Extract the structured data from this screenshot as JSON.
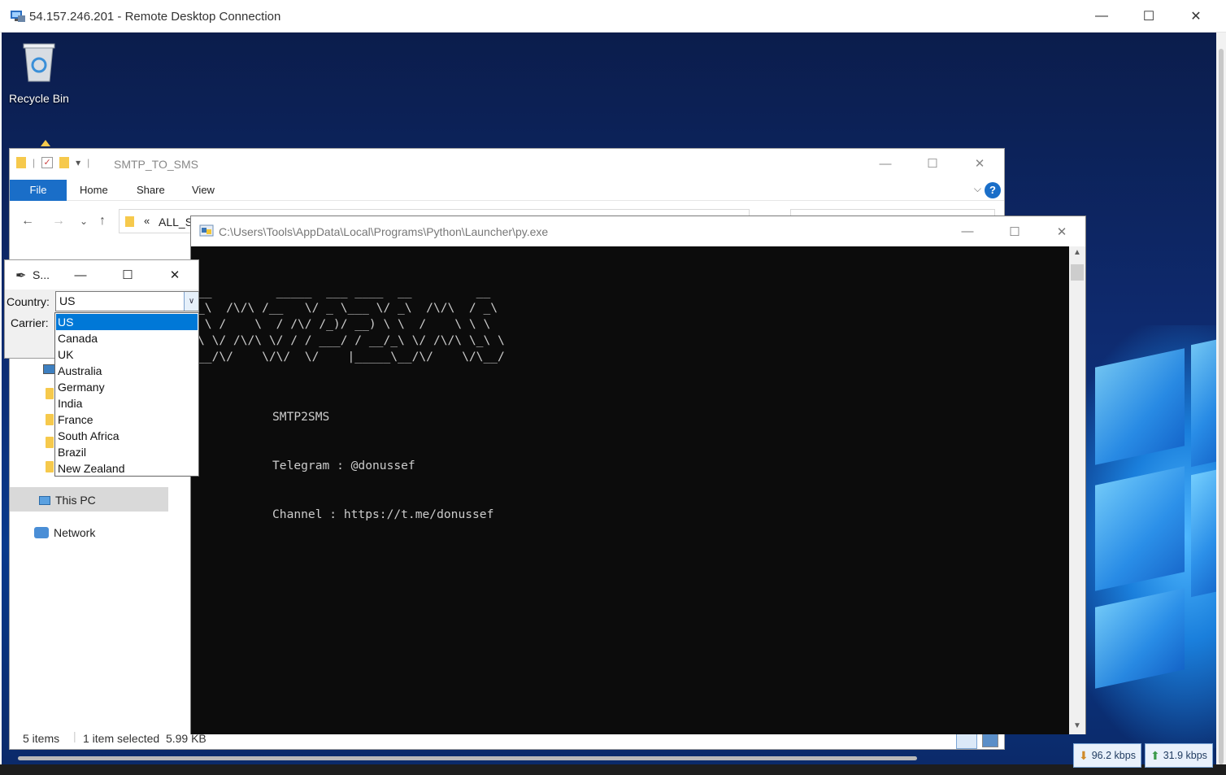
{
  "rdp": {
    "title": "54.157.246.201 - Remote Desktop Connection",
    "minimize_icon": "minimize-icon",
    "maximize_icon": "maximize-icon",
    "close_icon": "close-icon"
  },
  "desktop": {
    "recycle_bin_label": "Recycle Bin"
  },
  "explorer": {
    "title": "SMTP_TO_SMS",
    "ribbon_tabs": [
      "File",
      "Home",
      "Share",
      "View"
    ],
    "address_crumb": "ALL_SI",
    "address_prefix": "«",
    "nav_this_pc": "This PC",
    "nav_network": "Network",
    "status_items": "5 items",
    "status_selected": "1 item selected  5.99 KB"
  },
  "console": {
    "title": "C:\\Users\\Tools\\AppData\\Local\\Programs\\Python\\Launcher\\py.exe",
    "ascii_art": "__         _____  ___ ____  __         __\n_\\  /\\/\\ /__   \\/ _ \\___ \\/ _\\  /\\/\\  / _\\\n \\ /    \\  / /\\/ /_)/ __) \\ \\  /    \\ \\ \\\n\\ \\/ /\\/\\ \\/ / / ___/ / __/_\\ \\/ /\\/\\ \\_\\ \\\n__/\\/    \\/\\/  \\/    |_____\\__/\\/    \\/\\__/",
    "info_lines": [
      "SMTP2SMS",
      "Telegram : @donussef",
      "Channel : https://t.me/donussef"
    ]
  },
  "tkapp": {
    "title": "S...",
    "country_label": "Country:",
    "carrier_label": "Carrier:",
    "country_value": "US",
    "country_options": [
      "US",
      "Canada",
      "UK",
      "Australia",
      "Germany",
      "India",
      "France",
      "South Africa",
      "Brazil",
      "New Zealand"
    ],
    "selected_option": "US"
  },
  "netmeter": {
    "down": "96.2 kbps",
    "up": "31.9 kbps"
  },
  "colors": {
    "accent_blue": "#1a6ec8",
    "selection_blue": "#0078d7",
    "console_bg": "#0c0c0c",
    "console_text": "#cccccc"
  }
}
